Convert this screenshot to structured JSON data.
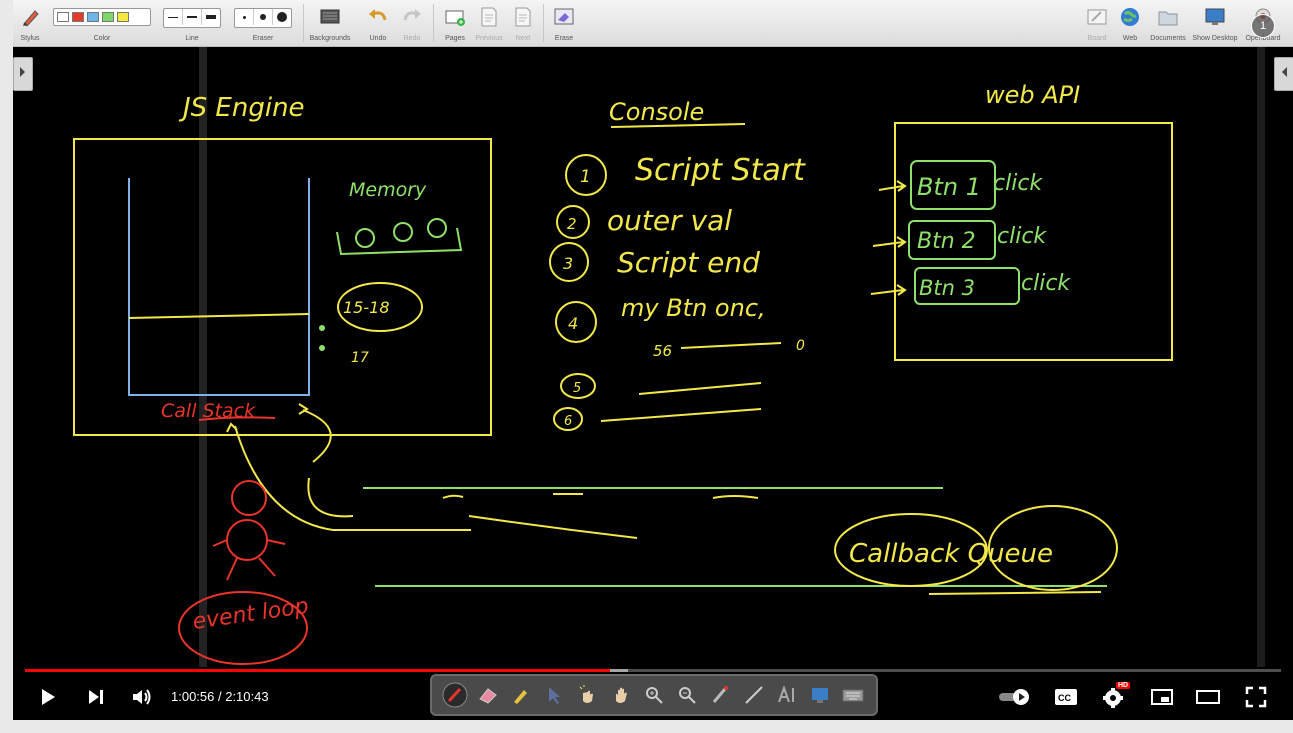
{
  "toolbar": {
    "stylus": "Stylus",
    "color": "Color",
    "line": "Line",
    "eraser": "Eraser",
    "backgrounds": "Backgrounds",
    "undo": "Undo",
    "redo": "Redo",
    "pages": "Pages",
    "previous": "Previous",
    "next": "Next",
    "erase": "Erase",
    "board": "Board",
    "web": "Web",
    "documents": "Documents",
    "show_desktop": "Show Desktop",
    "openboard": "Openboard",
    "swatches": [
      "#ffffff",
      "#e53b2a",
      "#6fb3e8",
      "#7fd46a",
      "#f3ea3a"
    ],
    "notification_count": "1"
  },
  "board": {
    "js_engine": "JS  Engine",
    "memory": "Memory",
    "console": "Console",
    "web_api": "web  API",
    "console_lines": [
      {
        "num": "1",
        "text": "Script  Start"
      },
      {
        "num": "2",
        "text": "outer val"
      },
      {
        "num": "3",
        "text": "Script  end"
      },
      {
        "num": "4",
        "text": "my Btn onc,"
      },
      {
        "num": "5",
        "text": ""
      },
      {
        "num": "6",
        "text": ""
      }
    ],
    "line4_sub": "56",
    "line4_end": "0",
    "memory_value": "15-18",
    "memory_num": "17",
    "call_stack": "Call  Stack",
    "event_loop": "event loop",
    "callback_queue": "Callback  Queue",
    "web_api_items": [
      {
        "btn": "Btn 1",
        "event": "click"
      },
      {
        "btn": "Btn 2",
        "event": "click"
      },
      {
        "btn": "Btn 3",
        "event": "click"
      }
    ]
  },
  "player": {
    "current_time": "1:00:56",
    "separator": " / ",
    "duration": "2:10:43",
    "played_fraction": 0.466,
    "buffered_fraction": 0.48,
    "hd_badge": "HD"
  },
  "colors": {
    "yellow": "#f2e84a",
    "green": "#8fe06a",
    "red": "#e8342a",
    "blue": "#7fb0e8",
    "progress": "#ff0000"
  }
}
